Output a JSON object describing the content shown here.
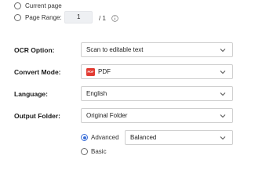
{
  "page_scope": {
    "options": [
      {
        "label": "Current page",
        "selected": false
      },
      {
        "label": "Page Range:",
        "selected": false
      }
    ],
    "range_from": "1",
    "range_total": "/ 1",
    "info_icon": "info-circle-icon"
  },
  "ocr_option": {
    "label": "OCR Option:",
    "value": "Scan to editable text"
  },
  "convert_mode": {
    "label": "Convert Mode:",
    "value": "PDF",
    "icon": "pdf-file-icon",
    "icon_text": "PDF",
    "icon_color": "#e23b32"
  },
  "language": {
    "label": "Language:",
    "value": "English"
  },
  "output_folder": {
    "label": "Output Folder:",
    "value": "Original Folder"
  },
  "quality": {
    "options": [
      {
        "label": "Advanced",
        "selected": true
      },
      {
        "label": "Basic",
        "selected": false
      }
    ],
    "advanced_level": "Balanced"
  },
  "colors": {
    "accent": "#3b6fd8",
    "pdf_red": "#e23b32",
    "input_bg": "#eef0f3"
  }
}
